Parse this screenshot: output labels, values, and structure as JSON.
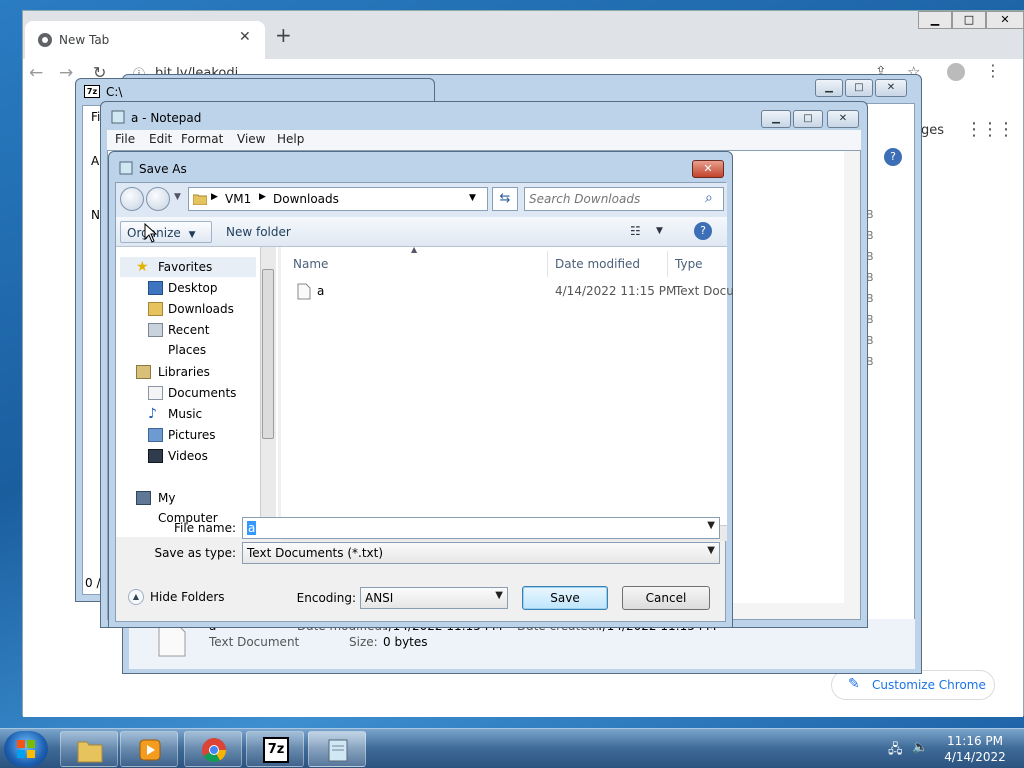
{
  "chrome": {
    "tab_title": "New Tab",
    "tab_close": "✕",
    "new_tab": "+",
    "address": "bit.ly/leakodi",
    "images_link": "ges",
    "customize_label": "Customize Chrome",
    "win_min": "▁",
    "win_max": "□",
    "win_close": "✕"
  },
  "sevenz": {
    "title": "C:\\",
    "menu_fragment": "Fi",
    "row_fragment": "A",
    "col_fragment": "N",
    "status_fragment": "0 /"
  },
  "explorer": {
    "size_col": [
      "B",
      "B",
      "B",
      "B",
      "B",
      "B",
      "B",
      "B"
    ],
    "details": {
      "name": "a",
      "type": "Text Document",
      "date_modified_label": "Date modified:",
      "date_modified": "4/14/2022 11:15 PM",
      "size_label": "Size:",
      "size": "0 bytes",
      "date_created_label": "Date created:",
      "date_created": "4/14/2022 11:15 PM"
    }
  },
  "notepad": {
    "title": "a - Notepad",
    "menu": [
      "File",
      "Edit",
      "Format",
      "View",
      "Help"
    ]
  },
  "saveas": {
    "title": "Save As",
    "close": "✕",
    "breadcrumb": [
      "VM1",
      "Downloads"
    ],
    "search_placeholder": "Search Downloads",
    "organize": "Organize",
    "new_folder": "New folder",
    "help": "?",
    "nav": {
      "favorites": "Favorites",
      "desktop": "Desktop",
      "downloads": "Downloads",
      "recent": "Recent Places",
      "libraries": "Libraries",
      "documents": "Documents",
      "music": "Music",
      "pictures": "Pictures",
      "videos": "Videos",
      "computer": "My Computer"
    },
    "columns": {
      "name": "Name",
      "date": "Date modified",
      "type": "Type"
    },
    "files": [
      {
        "name": "a",
        "date": "4/14/2022 11:15 PM",
        "type": "Text Docu"
      }
    ],
    "file_name_label": "File name:",
    "file_name_value": "a",
    "save_as_type_label": "Save as type:",
    "save_as_type_value": "Text Documents (*.txt)",
    "hide_folders": "Hide Folders",
    "encoding_label": "Encoding:",
    "encoding_value": "ANSI",
    "save": "Save",
    "cancel": "Cancel"
  },
  "taskbar": {
    "time": "11:16 PM",
    "date": "4/14/2022",
    "sevenzip_label": "7z"
  },
  "colors": {
    "accent": "#1a73e8",
    "selection": "#3399ff",
    "window_frame": "#bcd3ea"
  }
}
